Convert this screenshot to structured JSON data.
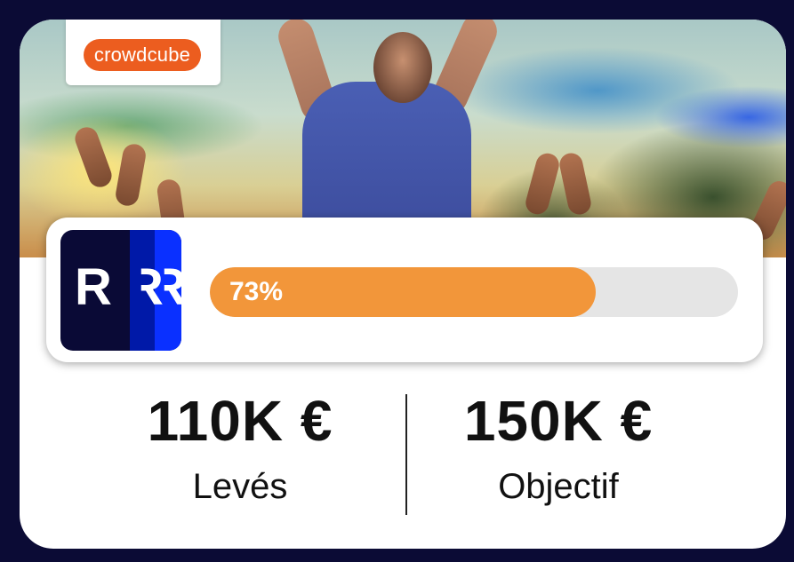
{
  "brand": {
    "name": "crowdcube",
    "color": "#ec5d1f"
  },
  "company": {
    "logo_text": "R R R",
    "logo_colors": [
      "#0a0a36",
      "#0019a8",
      "#0a30ff"
    ]
  },
  "progress": {
    "percent_label": "73%",
    "fraction": 0.73,
    "fill_color": "#f2963a"
  },
  "stats": {
    "raised": {
      "value": "110K €",
      "label": "Levés"
    },
    "goal": {
      "value": "150K €",
      "label": "Objectif"
    }
  },
  "hero": {
    "icon": "crowd-photo"
  }
}
